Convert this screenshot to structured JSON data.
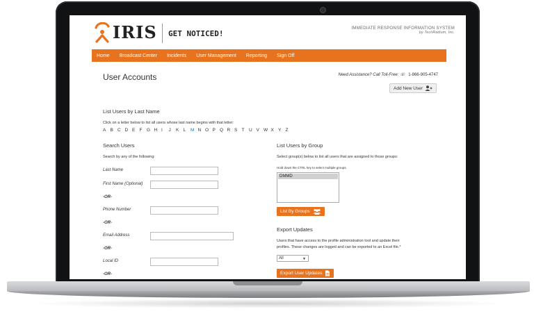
{
  "header": {
    "logo_text": "IRIS",
    "tagline": "GET NOTICED!",
    "system_name": "IMMEDIATE RESPONSE INFORMATION SYSTEM",
    "system_by": "by TechRadium, Inc."
  },
  "nav": [
    "Home",
    "Broadcast Center",
    "Incidents",
    "User Management",
    "Reporting",
    "Sign Off"
  ],
  "page": {
    "title": "User Accounts",
    "assist_label": "Need Assistance? Call Toll-Free:",
    "assist_phone": "1-866-905-4747",
    "add_user_label": "Add New User"
  },
  "by_last_name": {
    "title": "List Users by Last Name",
    "instructions": "Click on a letter below to list all users whose last name begins with that letter:",
    "letters": [
      "A",
      "B",
      "C",
      "D",
      "E",
      "F",
      "G",
      "H",
      "I",
      "J",
      "K",
      "L",
      "M",
      "N",
      "O",
      "P",
      "Q",
      "R",
      "S",
      "T",
      "U",
      "V",
      "W",
      "X",
      "Y",
      "Z"
    ],
    "active_letter": "M"
  },
  "search": {
    "title": "Search Users",
    "instructions": "Search by any of the following:",
    "last_name_label": "Last Name",
    "first_name_label": "First Name (Optional)",
    "or1": "-OR-",
    "phone_label": "Phone Number",
    "or2": "-OR-",
    "email_label": "Email Address",
    "or3": "-OR-",
    "local_id_label": "Local ID",
    "or4": "-OR-"
  },
  "groups": {
    "title": "List Users by Group",
    "instructions": "Select group(s) below to list all users that are assigned to those groups:",
    "hint": "Hold down the CTRL key to select multiple groups.",
    "options": [
      "DMMD"
    ],
    "button_label": "List By Groups"
  },
  "export": {
    "title": "Export Updates",
    "description_1": "Users that have access to the profile administration tool and update their",
    "description_2": "profiles. These changes are logged and can be exported to an Excel file.*",
    "select_value": "All",
    "button_label": "Export User Updates"
  },
  "colors": {
    "accent": "#e8731f",
    "active_letter": "#2a7ab8"
  }
}
